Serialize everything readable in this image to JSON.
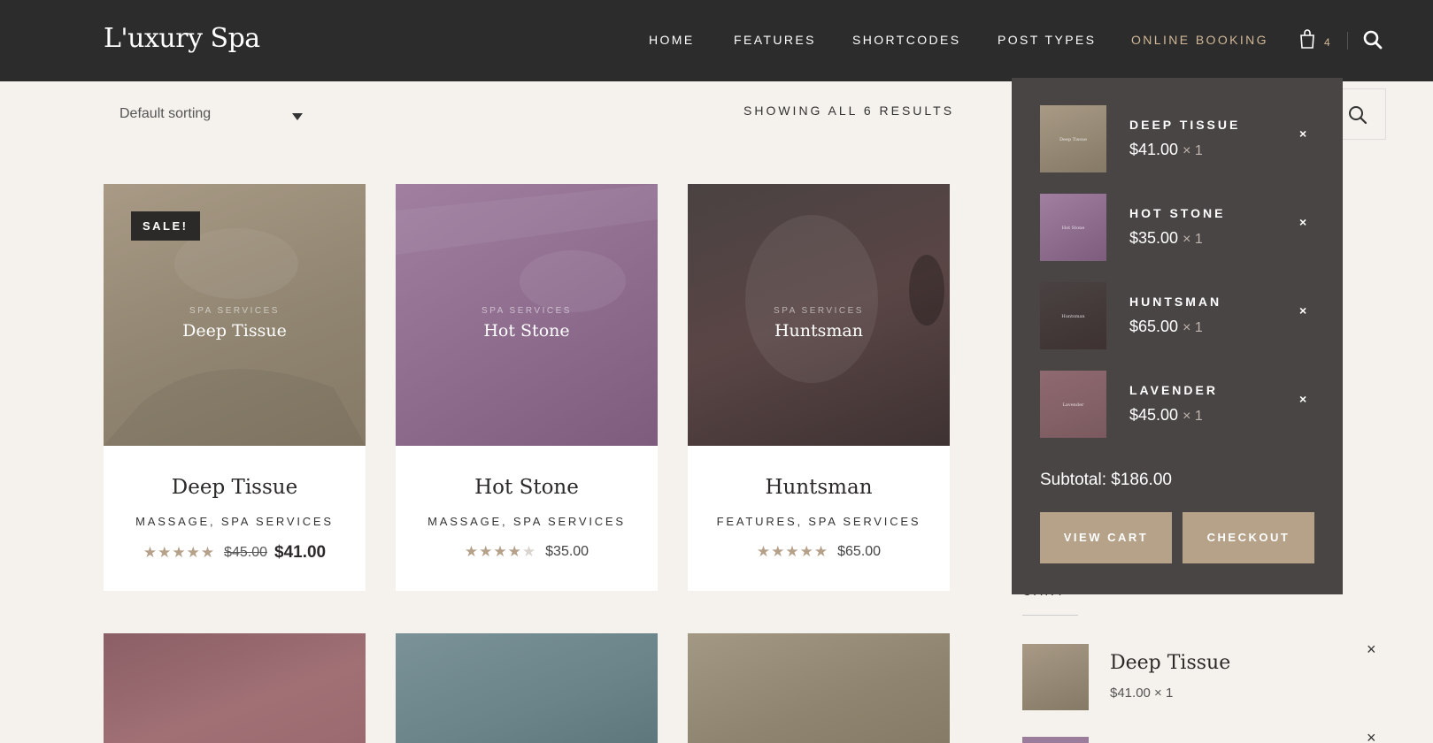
{
  "brand": {
    "logo": "L'uxury Spa"
  },
  "nav": {
    "items": [
      {
        "label": "HOME"
      },
      {
        "label": "FEATURES"
      },
      {
        "label": "SHORTCODES"
      },
      {
        "label": "POST TYPES"
      },
      {
        "label": "ONLINE BOOKING"
      }
    ],
    "active_index": 4,
    "cart_count": "4",
    "accent_color": "#d2b898"
  },
  "toolbar": {
    "sorting_selected": "Default sorting",
    "results_text": "SHOWING ALL 6 RESULTS"
  },
  "products": [
    {
      "image_subtitle": "SPA SERVICES",
      "image_title": "Deep Tissue",
      "badge": "SALE!",
      "title": "Deep Tissue",
      "categories": "MASSAGE, SPA SERVICES",
      "rating": 5,
      "old_price": "$45.00",
      "price": "$41.00"
    },
    {
      "image_subtitle": "SPA SERVICES",
      "image_title": "Hot Stone",
      "title": "Hot Stone",
      "categories": "MASSAGE, SPA SERVICES",
      "rating": 4,
      "price": "$35.00"
    },
    {
      "image_subtitle": "SPA SERVICES",
      "image_title": "Huntsman",
      "title": "Huntsman",
      "categories": "FEATURES, SPA SERVICES",
      "rating": 5,
      "price": "$65.00"
    }
  ],
  "mini_cart": {
    "items": [
      {
        "name": "DEEP TISSUE",
        "price": "$41.00",
        "qty": "× 1",
        "thumb_label": "Deep Tissue"
      },
      {
        "name": "HOT STONE",
        "price": "$35.00",
        "qty": "× 1",
        "thumb_label": "Hot Stone"
      },
      {
        "name": "HUNTSMAN",
        "price": "$65.00",
        "qty": "× 1",
        "thumb_label": "Huntsman"
      },
      {
        "name": "LAVENDER",
        "price": "$45.00",
        "qty": "× 1",
        "thumb_label": "Lavender"
      }
    ],
    "remove_symbol": "×",
    "subtotal": "Subtotal: $186.00",
    "view_cart": "VIEW CART",
    "checkout": "CHECKOUT"
  },
  "sidebar": {
    "cart_widget_title": "CART",
    "item_name": "Deep Tissue",
    "item_price": "$41.00 × 1",
    "remove_symbol": "×"
  }
}
